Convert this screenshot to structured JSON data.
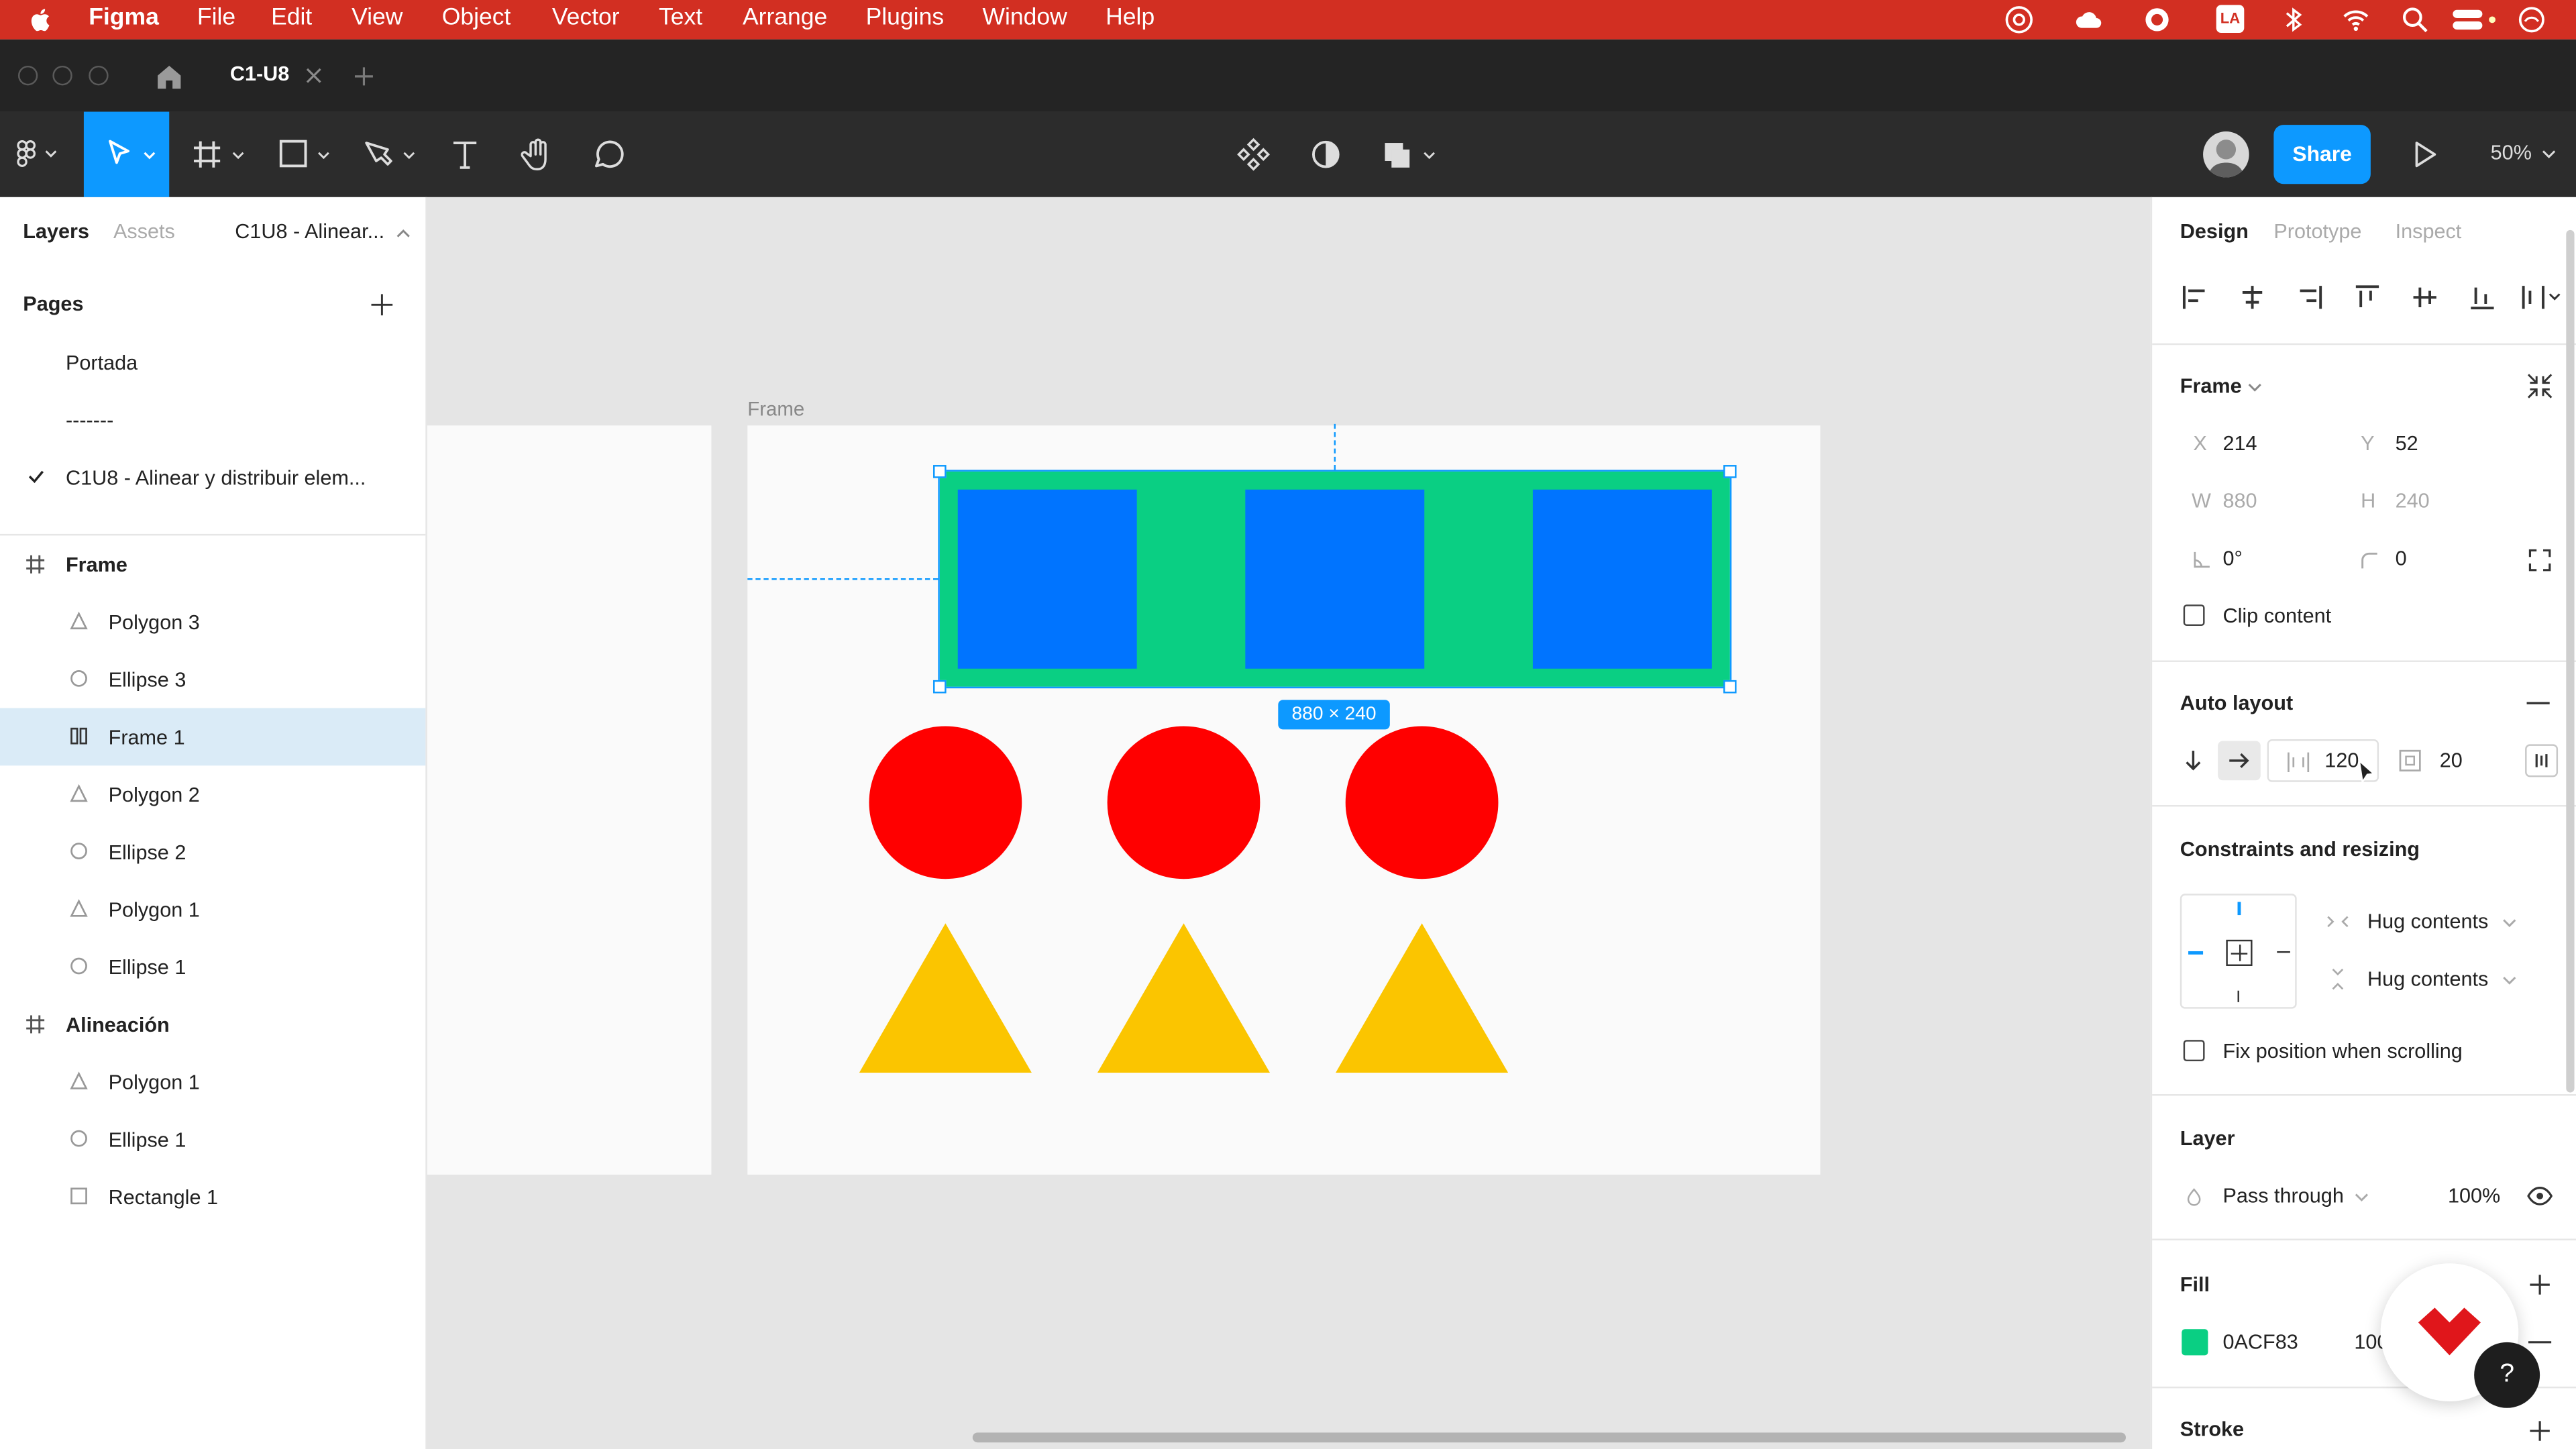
{
  "menubar": {
    "app": "Figma",
    "items": [
      "File",
      "Edit",
      "View",
      "Object",
      "Vector",
      "Text",
      "Arrange",
      "Plugins",
      "Window",
      "Help"
    ],
    "status_icons": [
      "apple-icon",
      "creative-cloud-icon",
      "cloud-icon",
      "sync-icon",
      "input-source-icon",
      "bluetooth-icon",
      "wifi-icon",
      "spotlight-search-icon",
      "control-center-icon",
      "siri-icon"
    ],
    "input_source": "LA"
  },
  "tabbar": {
    "tab_title": "C1-U8"
  },
  "toolbar": {
    "share": "Share",
    "zoom": "50%"
  },
  "left_panel": {
    "tabs": {
      "layers": "Layers",
      "assets": "Assets"
    },
    "page_selector": "C1U8 - Alinear...",
    "pages_title": "Pages",
    "pages": [
      {
        "label": "Portada"
      },
      {
        "label": "-------"
      },
      {
        "label": "C1U8 - Alinear y distribuir elem..."
      }
    ],
    "layers": [
      {
        "label": "Frame",
        "icon": "frame-icon"
      },
      {
        "label": "Polygon 3",
        "icon": "polygon-icon"
      },
      {
        "label": "Ellipse 3",
        "icon": "ellipse-icon"
      },
      {
        "label": "Frame 1",
        "icon": "auto-layout-icon"
      },
      {
        "label": "Polygon 2",
        "icon": "polygon-icon"
      },
      {
        "label": "Ellipse 2",
        "icon": "ellipse-icon"
      },
      {
        "label": "Polygon 1",
        "icon": "polygon-icon"
      },
      {
        "label": "Ellipse 1",
        "icon": "ellipse-icon"
      },
      {
        "label": "Alineación",
        "icon": "frame-icon"
      },
      {
        "label": "Polygon 1",
        "icon": "polygon-icon"
      },
      {
        "label": "Ellipse 1",
        "icon": "ellipse-icon"
      },
      {
        "label": "Rectangle 1",
        "icon": "rectangle-icon"
      }
    ]
  },
  "canvas": {
    "frame_label": "Frame",
    "size_badge": "880 × 240",
    "colors": {
      "green": "#0ACF83",
      "blue": "#0074FF",
      "red": "#FF0000",
      "yellow": "#FBC500"
    }
  },
  "right_panel": {
    "tabs": {
      "design": "Design",
      "prototype": "Prototype",
      "inspect": "Inspect"
    },
    "frame_section": "Frame",
    "x_label": "X",
    "x": "214",
    "y_label": "Y",
    "y": "52",
    "w_label": "W",
    "w": "880",
    "h_label": "H",
    "h": "240",
    "rotation": "0°",
    "radius": "0",
    "clip_content": "Clip content",
    "auto_layout_title": "Auto layout",
    "spacing": "120",
    "padding": "20",
    "constraints_title": "Constraints and resizing",
    "hug_h": "Hug contents",
    "hug_v": "Hug contents",
    "fix_position": "Fix position when scrolling",
    "layer_title": "Layer",
    "blend": "Pass through",
    "opacity": "100%",
    "fill_title": "Fill",
    "fill_hex": "0ACF83",
    "fill_opacity": "100",
    "stroke_title": "Stroke"
  }
}
